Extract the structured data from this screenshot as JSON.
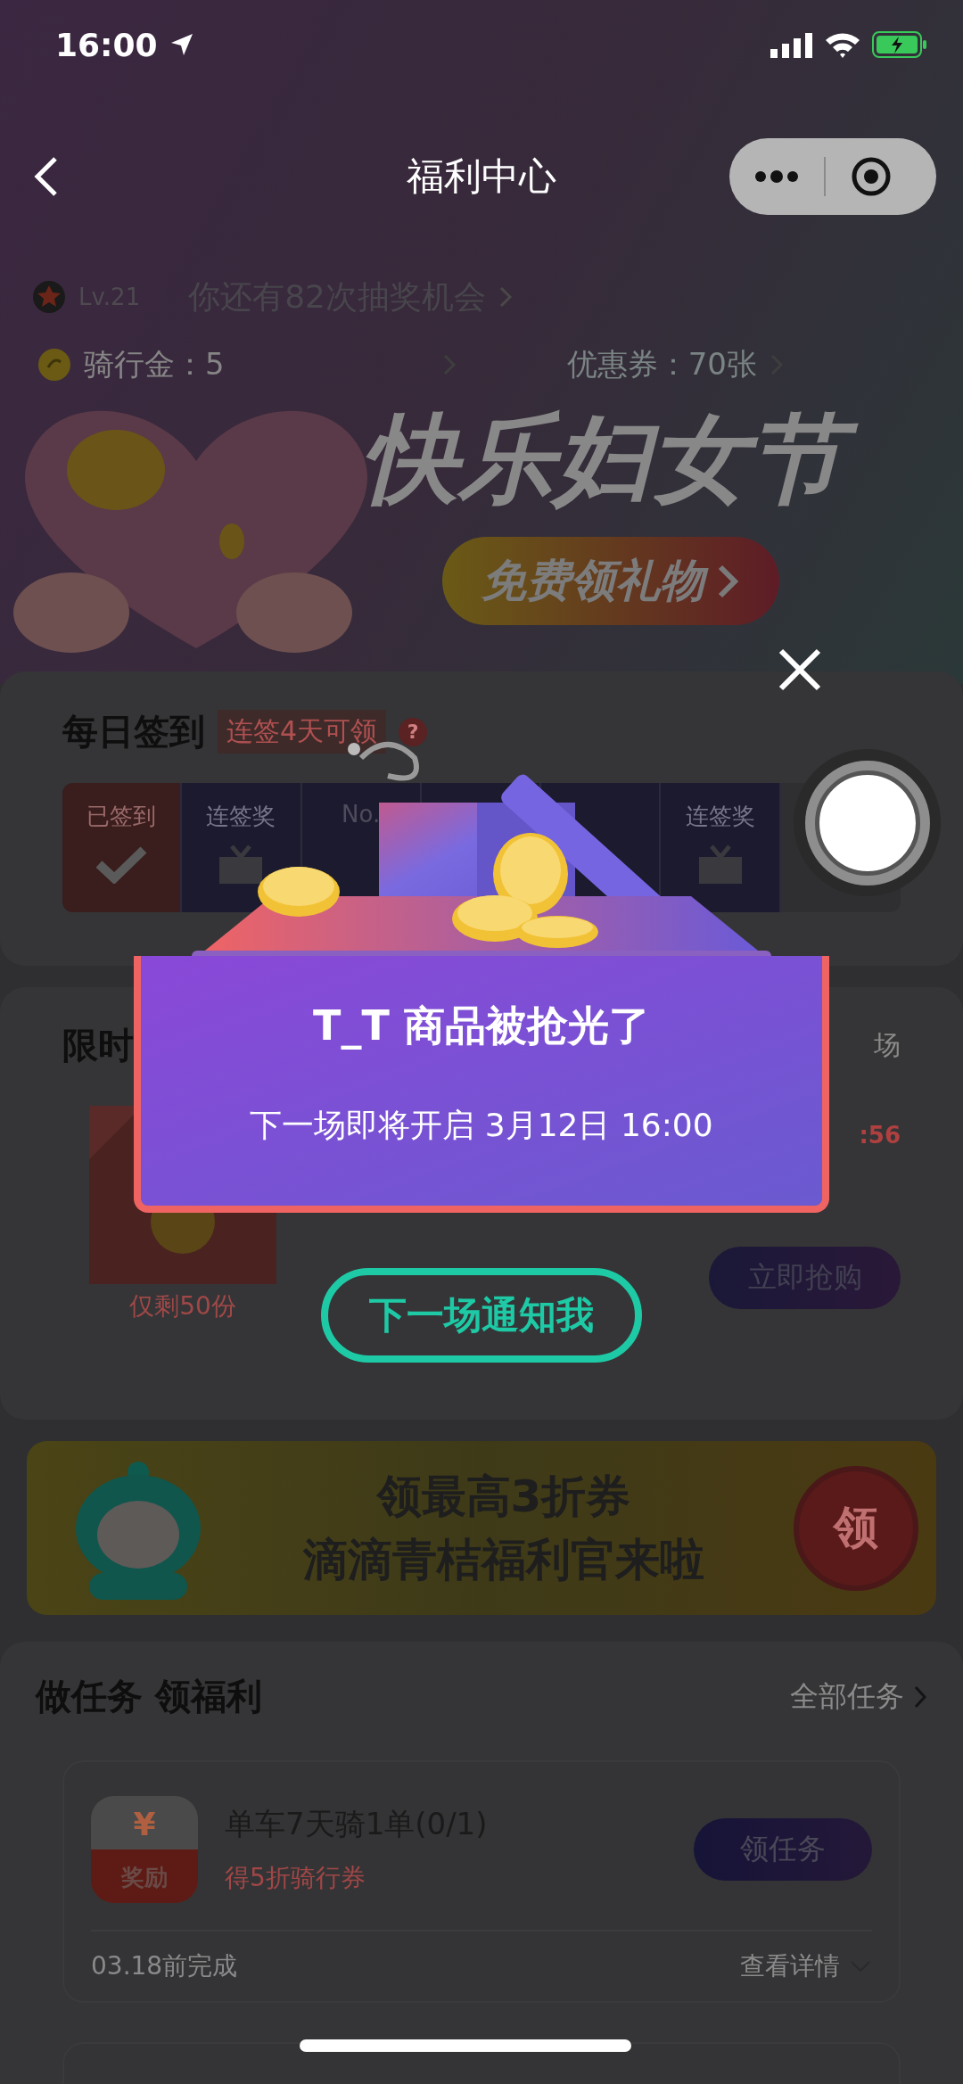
{
  "status_bar": {
    "time": "16:00"
  },
  "nav": {
    "title": "福利中心"
  },
  "account": {
    "level": "Lv.21",
    "lottery": "你还有82次抽奖机会",
    "riding_gold": "骑行金：5",
    "coupons": "优惠券：70张"
  },
  "hero": {
    "headline": "快乐妇女节",
    "button": "免费领礼物"
  },
  "daily_checkin": {
    "title": "每日签到",
    "hint": "连签4天可领",
    "help_mark": "?",
    "days": [
      {
        "kind": "day",
        "label": "已签到",
        "signed": true
      },
      {
        "kind": "reward",
        "label": "连签奖",
        "signed": false
      },
      {
        "kind": "day",
        "label": "No.",
        "signed": false
      },
      {
        "kind": "day",
        "signed": false
      },
      {
        "kind": "day",
        "signed": false
      },
      {
        "kind": "reward",
        "label": "连签奖",
        "signed": false
      }
    ]
  },
  "flash_sale": {
    "title": "限时",
    "side_label": "场",
    "stock": "仅剩50份",
    "countdown": ":56",
    "button": "立即抢购"
  },
  "promo_banner": {
    "headline": "领最高**3**折券",
    "subline": "滴滴青桔福利官来啦",
    "button": "领"
  },
  "tasks": {
    "title": "做任务 领福利",
    "all_link": "全部任务",
    "items": [
      {
        "badge_symbol": "¥",
        "badge": "奖励",
        "title": "单车7天骑1单(0/1)",
        "reward": "得5折骑行券",
        "button": "领任务",
        "deadline": "03.18前完成",
        "details": "查看详情"
      }
    ]
  },
  "dialog": {
    "title": "T_T 商品被抢光了",
    "message": "下一场即将开启 3月12日 16:00",
    "button": "下一场通知我"
  }
}
